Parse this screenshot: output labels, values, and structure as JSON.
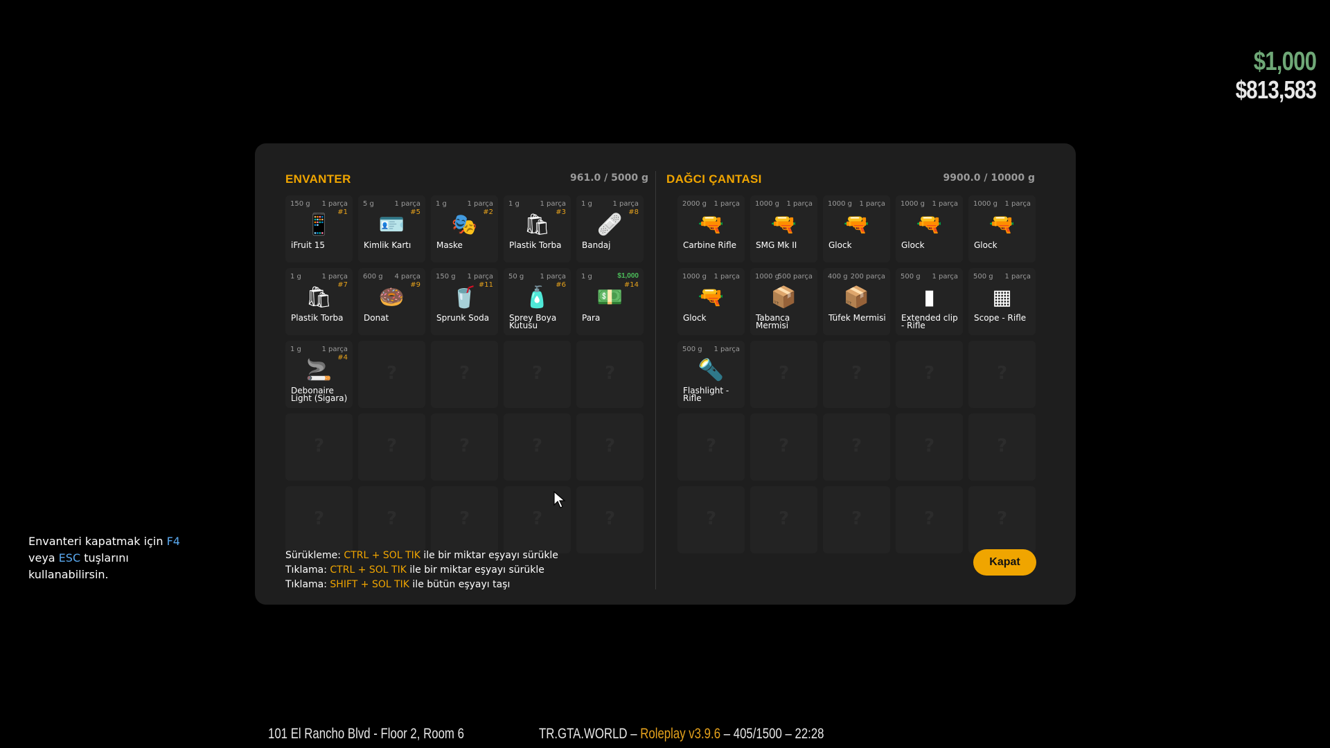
{
  "hud": {
    "cash": "$1,000",
    "bank": "$813,583"
  },
  "hint": {
    "line1_pre": "Envanteri kapatmak için ",
    "key1": "F4",
    "line2_pre": "veya ",
    "key2": "ESC",
    "line2_post": " tuşlarını",
    "line3": "kullanabilirsin."
  },
  "status": {
    "address": "101 El Rancho Blvd - Floor 2, Room 6",
    "server": "TR.GTA.WORLD – ",
    "version": "Roleplay v3.9.6",
    "stats": " – 405/1500 – 22:28"
  },
  "inventory": {
    "title": "ENVANTER",
    "weight": "961.0 / 5000 g",
    "items": [
      {
        "w": "150 g",
        "q": "1 parça",
        "n": "#1",
        "icon": "phone-icon",
        "glyph": "📱",
        "label": "iFruit 15"
      },
      {
        "w": "5 g",
        "q": "1 parça",
        "n": "#5",
        "icon": "id-card-icon",
        "glyph": "🪪",
        "label": "Kimlik Kartı"
      },
      {
        "w": "1 g",
        "q": "1 parça",
        "n": "#2",
        "icon": "mask-icon",
        "glyph": "🎭",
        "label": "Maske"
      },
      {
        "w": "1 g",
        "q": "1 parça",
        "n": "#3",
        "icon": "bag-icon",
        "glyph": "🛍",
        "label": "Plastik Torba"
      },
      {
        "w": "1 g",
        "q": "1 parça",
        "n": "#8",
        "icon": "bandage-icon",
        "glyph": "🩹",
        "label": "Bandaj"
      },
      {
        "w": "1 g",
        "q": "1 parça",
        "n": "#7",
        "icon": "bag-icon",
        "glyph": "🛍",
        "label": "Plastik Torba"
      },
      {
        "w": "600 g",
        "q": "4 parça",
        "n": "#9",
        "icon": "donut-icon",
        "glyph": "🍩",
        "label": "Donat"
      },
      {
        "w": "150 g",
        "q": "1 parça",
        "n": "#11",
        "icon": "soda-icon",
        "glyph": "🥤",
        "label": "Sprunk Soda"
      },
      {
        "w": "50 g",
        "q": "1 parça",
        "n": "#6",
        "icon": "spray-can-icon",
        "glyph": "🧴",
        "label": "Sprey Boya Kutusu"
      },
      {
        "w": "1 g",
        "q": "$1,000",
        "n": "#14",
        "icon": "cash-icon",
        "glyph": "💵",
        "label": "Para",
        "money": true
      },
      {
        "w": "1 g",
        "q": "1 parça",
        "n": "#4",
        "icon": "cigarette-icon",
        "glyph": "🚬",
        "label": "Debonaire Light (Sigara)"
      }
    ],
    "total_slots": 25
  },
  "bag": {
    "title": "DAĞCI ÇANTASI",
    "weight": "9900.0 / 10000 g",
    "items": [
      {
        "w": "2000 g",
        "q": "1 parça",
        "n": "",
        "icon": "rifle-icon",
        "glyph": "🔫",
        "label": "Carbine Rifle"
      },
      {
        "w": "1000 g",
        "q": "1 parça",
        "n": "",
        "icon": "smg-icon",
        "glyph": "🔫",
        "label": "SMG Mk II"
      },
      {
        "w": "1000 g",
        "q": "1 parça",
        "n": "",
        "icon": "pistol-icon",
        "glyph": "🔫",
        "label": "Glock"
      },
      {
        "w": "1000 g",
        "q": "1 parça",
        "n": "",
        "icon": "pistol-icon",
        "glyph": "🔫",
        "label": "Glock"
      },
      {
        "w": "1000 g",
        "q": "1 parça",
        "n": "",
        "icon": "pistol-icon",
        "glyph": "🔫",
        "label": "Glock"
      },
      {
        "w": "1000 g",
        "q": "1 parça",
        "n": "",
        "icon": "pistol-icon",
        "glyph": "🔫",
        "label": "Glock"
      },
      {
        "w": "1000 g",
        "q": "500 parça",
        "n": "",
        "icon": "ammo-box-icon",
        "glyph": "📦",
        "label": "Tabanca Mermisi"
      },
      {
        "w": "400 g",
        "q": "200 parça",
        "n": "",
        "icon": "ammo-box-icon",
        "glyph": "📦",
        "label": "Tüfek Mermisi"
      },
      {
        "w": "500 g",
        "q": "1 parça",
        "n": "",
        "icon": "magazine-icon",
        "glyph": "▮",
        "label": "Extended clip - Rifle"
      },
      {
        "w": "500 g",
        "q": "1 parça",
        "n": "",
        "icon": "scope-icon",
        "glyph": "▦",
        "label": "Scope - Rifle"
      },
      {
        "w": "500 g",
        "q": "1 parça",
        "n": "",
        "icon": "flashlight-icon",
        "glyph": "🔦",
        "label": "Flashlight - Rifle"
      }
    ],
    "total_slots": 25
  },
  "help": [
    {
      "pre": "Sürükleme: ",
      "key": "CTRL + SOL TIK",
      "post": " ile bir miktar eşyayı sürükle"
    },
    {
      "pre": "Tıklama: ",
      "key": "CTRL + SOL TIK",
      "post": " ile bir miktar eşyayı sürükle"
    },
    {
      "pre": "Tıklama: ",
      "key": "SHIFT + SOL TIK",
      "post": " ile bütün eşyayı taşı"
    }
  ],
  "close_label": "Kapat"
}
